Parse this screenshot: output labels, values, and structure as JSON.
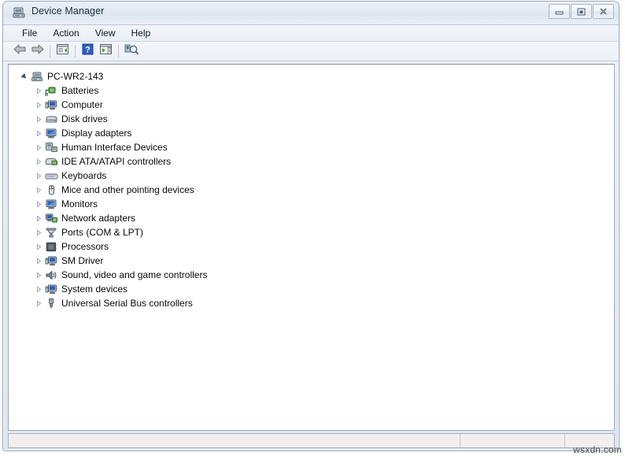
{
  "window": {
    "title": "Device Manager",
    "icon": "device-manager-icon",
    "buttons": [
      {
        "name": "minimize-button",
        "glyph": "minimize"
      },
      {
        "name": "restore-button",
        "glyph": "restore"
      },
      {
        "name": "close-button",
        "glyph": "close"
      }
    ]
  },
  "menubar": {
    "items": [
      {
        "label": "File"
      },
      {
        "label": "Action"
      },
      {
        "label": "View"
      },
      {
        "label": "Help"
      }
    ]
  },
  "toolbar": {
    "items": [
      {
        "name": "back-button",
        "icon": "back-arrow-icon"
      },
      {
        "name": "forward-button",
        "icon": "forward-arrow-icon"
      },
      {
        "name": "separator-1",
        "icon": "separator"
      },
      {
        "name": "show-properties-button",
        "icon": "properties-panel-icon"
      },
      {
        "name": "separator-2",
        "icon": "separator"
      },
      {
        "name": "help-button",
        "icon": "help-question-icon"
      },
      {
        "name": "update-driver-button",
        "icon": "console-panel-icon"
      },
      {
        "name": "separator-3",
        "icon": "separator"
      },
      {
        "name": "scan-hardware-changes-button",
        "icon": "scan-hardware-icon"
      }
    ]
  },
  "tree": {
    "root": {
      "label": "PC-WR2-143",
      "icon": "computer-root-icon",
      "expanded": true
    },
    "nodes": [
      {
        "label": "Batteries",
        "icon": "batteries-icon"
      },
      {
        "label": "Computer",
        "icon": "computer-icon"
      },
      {
        "label": "Disk drives",
        "icon": "disk-drive-icon"
      },
      {
        "label": "Display adapters",
        "icon": "display-adapter-icon"
      },
      {
        "label": "Human Interface Devices",
        "icon": "hid-icon"
      },
      {
        "label": "IDE ATA/ATAPI controllers",
        "icon": "ide-controller-icon"
      },
      {
        "label": "Keyboards",
        "icon": "keyboard-icon"
      },
      {
        "label": "Mice and other pointing devices",
        "icon": "mouse-icon"
      },
      {
        "label": "Monitors",
        "icon": "monitor-icon"
      },
      {
        "label": "Network adapters",
        "icon": "network-adapter-icon"
      },
      {
        "label": "Ports (COM & LPT)",
        "icon": "port-icon"
      },
      {
        "label": "Processors",
        "icon": "processor-icon"
      },
      {
        "label": "SM Driver",
        "icon": "sm-driver-icon"
      },
      {
        "label": "Sound, video and game controllers",
        "icon": "sound-speaker-icon"
      },
      {
        "label": "System devices",
        "icon": "system-device-icon"
      },
      {
        "label": "Universal Serial Bus controllers",
        "icon": "usb-controller-icon"
      }
    ]
  },
  "statusbar": {
    "main_text": "",
    "pane2_text": "",
    "pane3_text": ""
  },
  "watermark": {
    "text": "wsxdn.com"
  },
  "colors": {
    "title_text": "#17303f",
    "window_border": "#9aa9bd",
    "content_background": "#ffffff",
    "statusbar_background": "#f2efee"
  }
}
